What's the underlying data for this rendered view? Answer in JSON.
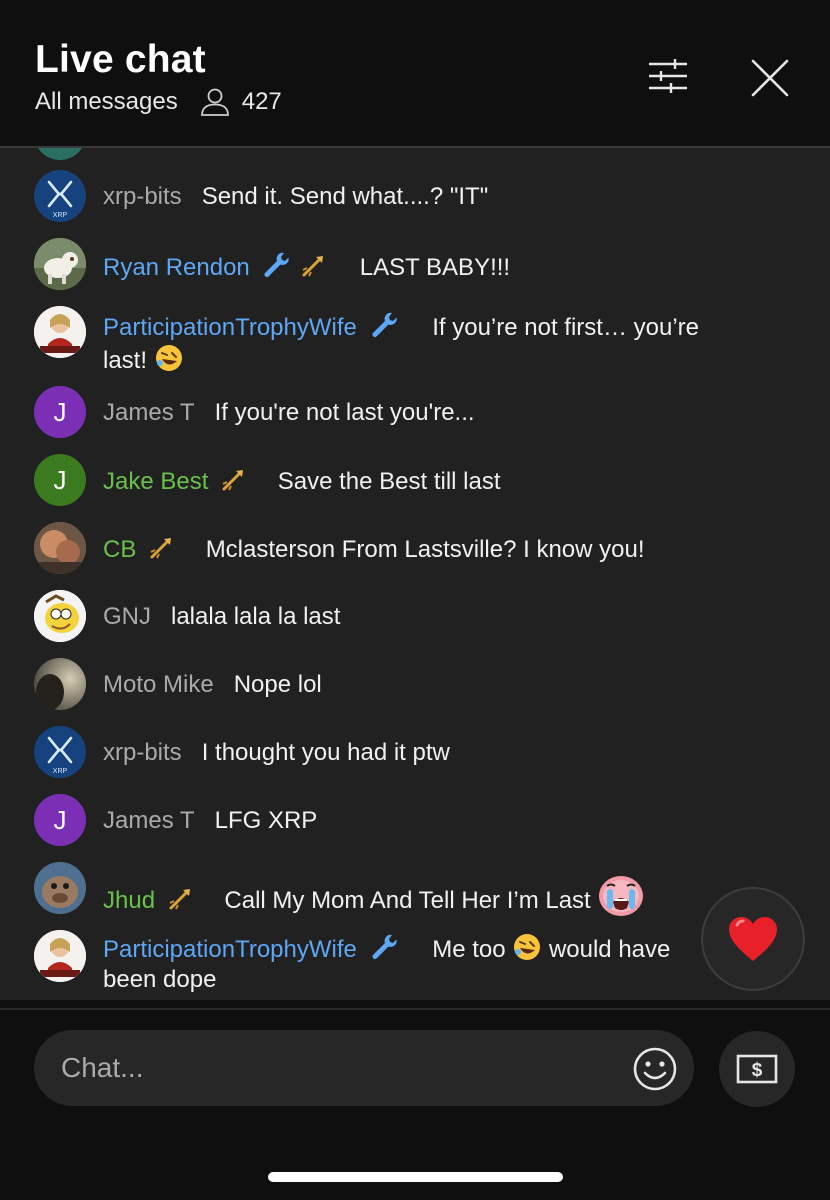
{
  "header": {
    "title": "Live chat",
    "filter_label": "All messages",
    "viewer_count": "427"
  },
  "messages": [
    {
      "author": "xrp-bits",
      "text": "Send it. Send what....? \"IT\""
    },
    {
      "author": "Ryan Rendon",
      "text": "LAST BABY!!!"
    },
    {
      "author": "ParticipationTrophyWife",
      "text": "If you’re not first… you’re",
      "text2": "last!"
    },
    {
      "author": "James T",
      "avatar_letter": "J",
      "text": "If you're not last you're..."
    },
    {
      "author": "Jake Best",
      "avatar_letter": "J",
      "text": "Save the Best till last"
    },
    {
      "author": "CB",
      "text": "Mclasterson From Lastsville? I know you!"
    },
    {
      "author": "GNJ",
      "text": "lalala lala la last"
    },
    {
      "author": "Moto Mike",
      "text": "Nope lol"
    },
    {
      "author": "xrp-bits",
      "text": "I thought you had it ptw"
    },
    {
      "author": "James T",
      "avatar_letter": "J",
      "text": "LFG XRP"
    },
    {
      "author": "Jhud",
      "text": "Call My Mom And Tell Her I’m Last"
    },
    {
      "author": "ParticipationTrophyWife",
      "text_a": "Me too",
      "text_b": "would have",
      "text2": "been dope"
    }
  ],
  "avatar_text": {
    "xrp": "XRP"
  },
  "composer": {
    "placeholder": "Chat..."
  },
  "colors": {
    "background": "#0f0f0f",
    "chat_background": "#212121",
    "owner_blue": "#5ea7f5",
    "member_green": "#6bc04b",
    "author_gray": "#aaaaaa"
  },
  "icons": [
    "people-icon",
    "filter-sliders-icon",
    "close-icon",
    "wrench-icon",
    "rocket-icon",
    "heart-icon",
    "smiley-icon",
    "money-icon"
  ]
}
